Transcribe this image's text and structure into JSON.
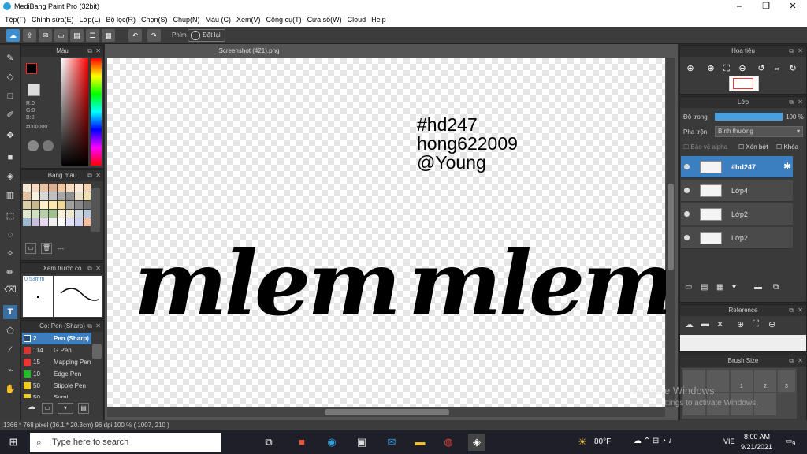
{
  "window": {
    "title": "MediBang Paint Pro (32bit)",
    "minimize": "–",
    "maximize": "❐",
    "close": "✕"
  },
  "menu": [
    "Tệp(F)",
    "Chỉnh sửa(E)",
    "Lớp(L)",
    "Bộ lọc(R)",
    "Chọn(S)",
    "Chụp(N)",
    "Màu (C)",
    "Xem(V)",
    "Công cụ(T)",
    "Cửa sổ(W)",
    "Cloud",
    "Help"
  ],
  "toolbar": {
    "key_label": "Phím",
    "reset_label": "Đặt lại"
  },
  "document": {
    "tab_title": "Screenshot (421).png"
  },
  "canvas": {
    "line1": "#hd247",
    "line2": "hong622009",
    "line3": "@Young",
    "word_left": "mlem",
    "word_right": "mlem"
  },
  "color_panel": {
    "title": "Màu",
    "r": "R:0",
    "g": "G:0",
    "b": "B:0",
    "hex": "#000000",
    "current": "#000000"
  },
  "palette_panel": {
    "title": "Bảng màu",
    "footer": "---",
    "swatches": [
      "#f6e7d4",
      "#f4d9c0",
      "#e9c5a8",
      "#d8b092",
      "#f0c8a0",
      "#f7dcc0",
      "#fbe8d8",
      "#f2d2b0",
      "#e2c0a0",
      "#f5f0e0",
      "#d8d8d8",
      "#c0c0c0",
      "#a8a8a8",
      "#909090",
      "#e8e0c8",
      "#f0e0b0",
      "#dcd0a8",
      "#c8b890",
      "#fff0c8",
      "#ffe8b0",
      "#f0d898",
      "#a0a0a0",
      "#888888",
      "#707070",
      "#e0e8d0",
      "#d0e0c0",
      "#b8d0a8",
      "#a0c090",
      "#f8f0d8",
      "#eee8d0",
      "#d0d8e0",
      "#b8c8d8",
      "#a0b8d0",
      "#c8c0d8",
      "#e8d8f0",
      "#f0f0f0",
      "#ffffff",
      "#e0e0f8",
      "#d0d0f0",
      "#f8c0a0"
    ]
  },
  "brush_preview": {
    "title": "Xem trước cọ",
    "size": "0.53mm"
  },
  "brush_panel": {
    "title": "Cọ: Pen (Sharp)",
    "items": [
      {
        "size": "2",
        "name": "Pen (Sharp)",
        "color": "#ff4444"
      },
      {
        "size": "114",
        "name": "G Pen",
        "color": "#dd3333"
      },
      {
        "size": "15",
        "name": "Mapping Pen",
        "color": "#ee3333"
      },
      {
        "size": "10",
        "name": "Edge Pen",
        "color": "#22bb22"
      },
      {
        "size": "50",
        "name": "Stipple Pen",
        "color": "#eecc22"
      },
      {
        "size": "50",
        "name": "Sumi",
        "color": "#eecc22"
      }
    ]
  },
  "navigator": {
    "title": "Hoa tiêu"
  },
  "layer_panel": {
    "title": "Lớp",
    "opacity_label": "Độ trong",
    "opacity_value": "100 %",
    "blend_label": "Pha trộn",
    "blend_value": "Bình thường",
    "protect_alpha": "Bảo vệ alpha",
    "clip": "Xén bớt",
    "lock": "Khóa",
    "layers": [
      {
        "name": "#hd247",
        "selected": true
      },
      {
        "name": "Lớp4",
        "selected": false
      },
      {
        "name": "Lớp2",
        "selected": false
      },
      {
        "name": "Lớp2",
        "selected": false
      }
    ]
  },
  "reference_panel": {
    "title": "Reference"
  },
  "brush_size_panel": {
    "title": "Brush Size",
    "sizes": [
      "1",
      "2",
      "3"
    ]
  },
  "activation": {
    "line1": "Activate Windows",
    "line2": "Go to Settings to activate Windows."
  },
  "status": {
    "text": "1366 * 768 pixel  (36.1 * 20.3cm)  96 dpi  100 %  ( 1007, 210 )"
  },
  "taskbar": {
    "search_placeholder": "Type here to search",
    "weather": "80°F",
    "lang": "VIE",
    "time": "8:00 AM",
    "date": "9/21/2021",
    "notifications": "9"
  }
}
